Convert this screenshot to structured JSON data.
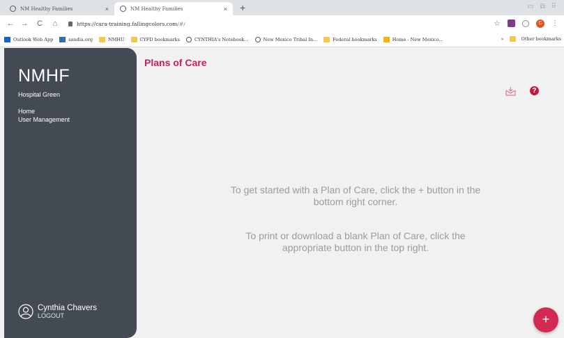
{
  "browser": {
    "tabs": [
      {
        "title": "NM Healthy Families"
      },
      {
        "title": "NM Healthy Families"
      }
    ],
    "tab_close_glyph": "×",
    "new_tab_glyph": "+",
    "window_controls": "▭ ⧉ ⠿",
    "url_host": "https://cara-training.fallingcolors.com",
    "url_path": "/#/",
    "profile_initial": "C",
    "bookmarks": [
      {
        "label": "Outlook Web App",
        "icon": "outlook-icon"
      },
      {
        "label": "sandia.org",
        "icon": "sandia-icon"
      },
      {
        "label": "NMHU",
        "icon": "folder-icon"
      },
      {
        "label": "CYFD bookmarks",
        "icon": "folder-icon"
      },
      {
        "label": "CYNTHIA's Notebook...",
        "icon": "globe-icon"
      },
      {
        "label": "New Mexico Tribal In...",
        "icon": "globe-icon"
      },
      {
        "label": "Federal bookmarks",
        "icon": "folder-icon"
      },
      {
        "label": "Home - New Mexico...",
        "icon": "nm-icon"
      }
    ],
    "bookmarks_overflow": "»",
    "other_bookmarks": "Other bookmarks"
  },
  "sidebar": {
    "brand": "NMHF",
    "organization": "Hospital Green",
    "nav": [
      {
        "label": "Home"
      },
      {
        "label": "User Management"
      }
    ],
    "user_name": "Cynthia Chavers",
    "logout_label": "LOGOUT"
  },
  "main": {
    "title": "Plans of Care",
    "empty_line1": "To get started with a Plan of Care, click the + button in the bottom right corner.",
    "empty_line2": "To print or download a blank Plan of Care, click the appropriate button in the top right.",
    "help_glyph": "?",
    "fab_glyph": "+"
  },
  "colors": {
    "accent": "#cc1f57",
    "sidebar_bg": "#434a54",
    "fab": "#d42a52"
  }
}
